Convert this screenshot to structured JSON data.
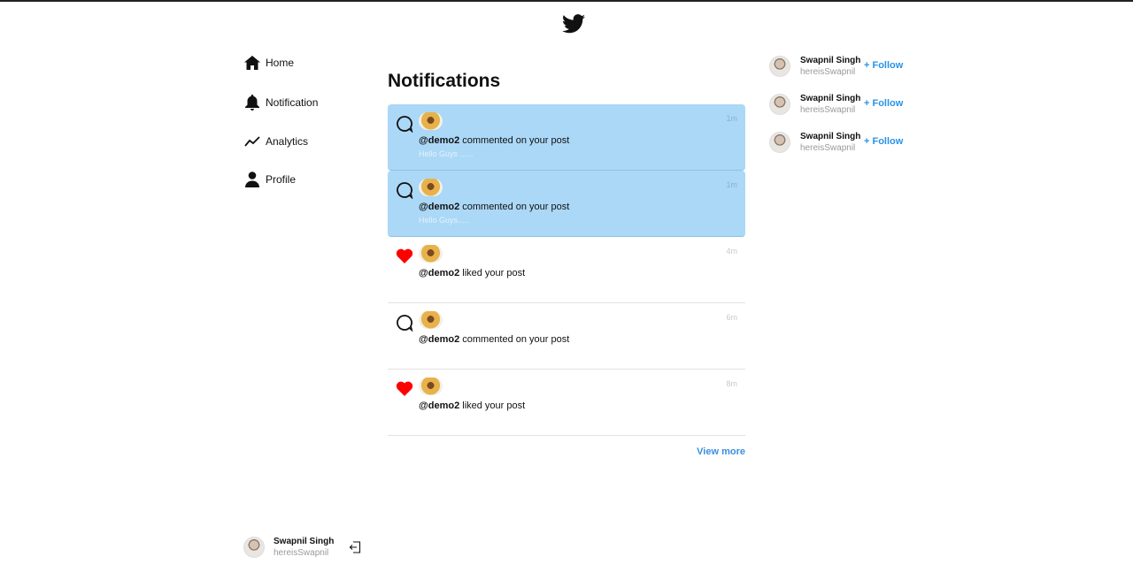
{
  "header": {
    "logo": "twitter-bird-icon"
  },
  "nav": {
    "items": [
      {
        "label": "Home",
        "icon": "home-icon"
      },
      {
        "label": "Notification",
        "icon": "bell-icon"
      },
      {
        "label": "Analytics",
        "icon": "trend-line-icon"
      },
      {
        "label": "Profile",
        "icon": "user-icon"
      }
    ]
  },
  "current_user": {
    "name": "Swapnil Singh",
    "handle": "hereisSwapnil"
  },
  "main": {
    "title": "Notifications",
    "notifications": [
      {
        "type": "comment",
        "user": "@demo2",
        "action": " commented on your post",
        "time": "1m",
        "preview": "Hello Guys ......",
        "unread": true
      },
      {
        "type": "comment",
        "user": "@demo2",
        "action": " commented on your post",
        "time": "1m",
        "preview": "Hello Guys.....",
        "unread": true
      },
      {
        "type": "like",
        "user": "@demo2",
        "action": " liked your post",
        "time": "4m",
        "preview": "",
        "unread": false
      },
      {
        "type": "comment",
        "user": "@demo2",
        "action": " commented on your post",
        "time": "6m",
        "preview": "",
        "unread": false
      },
      {
        "type": "like",
        "user": "@demo2",
        "action": " liked your post",
        "time": "8m",
        "preview": "",
        "unread": false
      }
    ],
    "view_more": "View more"
  },
  "suggestions": [
    {
      "name": "Swapnil Singh",
      "handle": "hereisSwapnil",
      "follow": "+ Follow"
    },
    {
      "name": "Swapnil Singh",
      "handle": "hereisSwapnil",
      "follow": "+ Follow"
    },
    {
      "name": "Swapnil Singh",
      "handle": "hereisSwapnil",
      "follow": "+ Follow"
    }
  ],
  "colors": {
    "unread_bg": "#abd8f7",
    "like": "#ff0000",
    "link": "#2a93e6"
  }
}
